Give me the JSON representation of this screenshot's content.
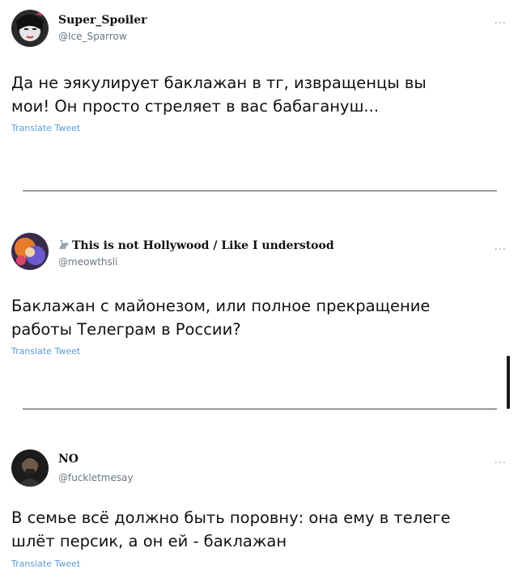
{
  "tweets": [
    {
      "display_name": "Super_Spoiler",
      "handle": "@Ice_Sparrow",
      "more": "...",
      "text_line1": "Да не эякулирует баклажан в тг, извращенцы вы",
      "text_line2": "мои! Он просто стреляет в вас бабагануш...",
      "translate": "Translate Tweet"
    },
    {
      "display_name": "This is not Hollywood / Like I understood",
      "handle": "@meowthsli",
      "more": "...",
      "text_line1": "Баклажан с майонезом, или полное прекращение",
      "text_line2": "работы Телеграм в России?",
      "translate": "Translate Tweet"
    },
    {
      "display_name": "NO",
      "handle": "@fuckletmesay",
      "more": "...",
      "text_line1": "В семье всё должно быть поровну: она ему в телеге",
      "text_line2": "шлёт персик, а он ей - баклажан",
      "translate": "Translate Tweet"
    }
  ],
  "icons": {
    "tweet2_name_prefix": "unicorn-icon",
    "more": "more-options-icon"
  }
}
